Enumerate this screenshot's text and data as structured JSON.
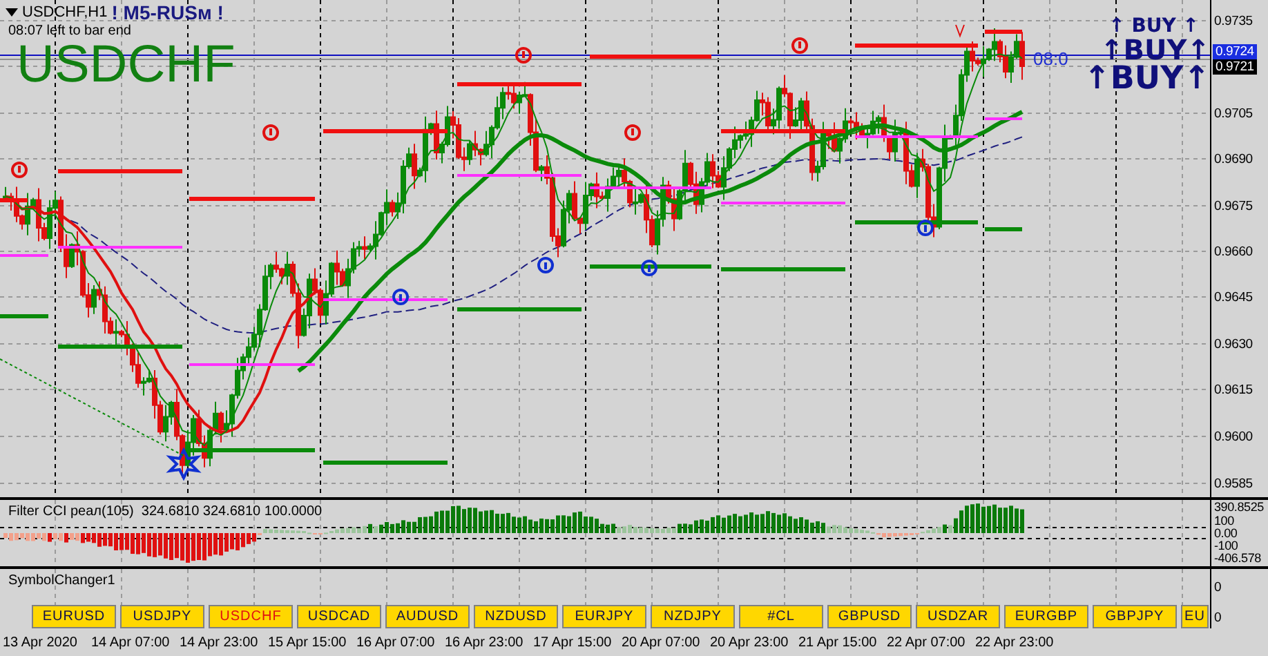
{
  "chart_header": {
    "symbol_timeframe": "USDCHF,H1",
    "indicator_label": "! M5-RUSм !",
    "timer": "08:07 left to bar end",
    "symbol_watermark": "USDCHF"
  },
  "signals": [
    {
      "text": "↑ BUY ↑",
      "kind": "small"
    },
    {
      "text": "↑BUY↑",
      "kind": "medium"
    },
    {
      "text": "↑BUY↑",
      "kind": "large"
    }
  ],
  "price_line_label": "08:0",
  "price_axis": {
    "labels": [
      "0.9735",
      "0.9705",
      "0.9690",
      "0.9675",
      "0.9660",
      "0.9645",
      "0.9630",
      "0.9615",
      "0.9600",
      "0.9585"
    ],
    "ask_tag": "0.9724",
    "bid_tag": "0.9721"
  },
  "indicator_pane": {
    "title": "Filter CCI реал(105)  324.6810 324.6810 100.0000",
    "axis_labels": [
      "390.8525",
      "100",
      "0.00",
      "-100",
      "-406.578"
    ]
  },
  "symbol_changer": {
    "title": "SymbolChanger1",
    "axis_labels": [
      "0",
      "0"
    ],
    "buttons": [
      {
        "label": "EURUSD",
        "selected": false
      },
      {
        "label": "USDJPY",
        "selected": false
      },
      {
        "label": "USDCHF",
        "selected": true
      },
      {
        "label": "USDCAD",
        "selected": false
      },
      {
        "label": "AUDUSD",
        "selected": false
      },
      {
        "label": "NZDUSD",
        "selected": false
      },
      {
        "label": "EURJPY",
        "selected": false
      },
      {
        "label": "NZDJPY",
        "selected": false
      },
      {
        "label": "#CL",
        "selected": false
      },
      {
        "label": "GBPUSD",
        "selected": false
      },
      {
        "label": "USDZAR",
        "selected": false
      },
      {
        "label": "EURGBP",
        "selected": false
      },
      {
        "label": "GBPJPY",
        "selected": false
      },
      {
        "label": "EU",
        "selected": false
      }
    ]
  },
  "time_axis": {
    "labels": [
      "13 Apr 2020",
      "14 Apr 07:00",
      "14 Apr 23:00",
      "15 Apr 15:00",
      "16 Apr 07:00",
      "16 Apr 23:00",
      "17 Apr 15:00",
      "20 Apr 07:00",
      "20 Apr 23:00",
      "21 Apr 15:00",
      "22 Apr 07:00",
      "22 Apr 23:00"
    ]
  }
}
